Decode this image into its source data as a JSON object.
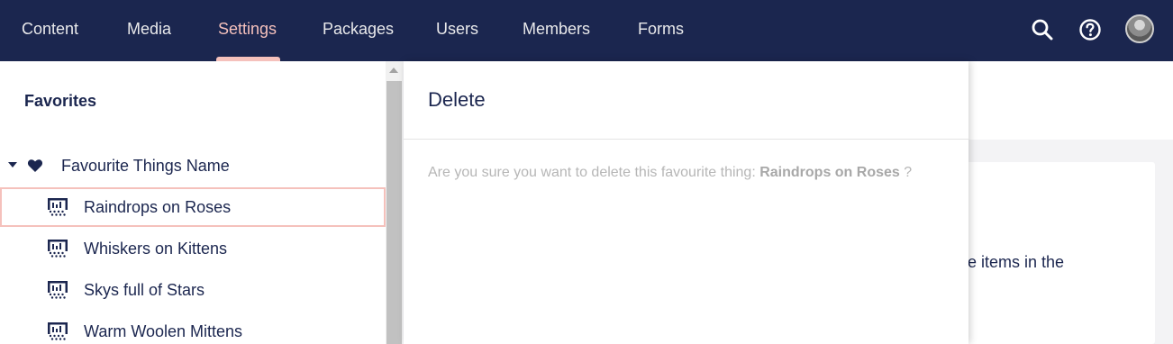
{
  "nav": {
    "items": [
      {
        "label": "Content"
      },
      {
        "label": "Media"
      },
      {
        "label": "Settings",
        "active": true
      },
      {
        "label": "Packages"
      },
      {
        "label": "Users"
      },
      {
        "label": "Members"
      },
      {
        "label": "Forms"
      }
    ],
    "icons": [
      "search-icon",
      "help-icon",
      "avatar"
    ]
  },
  "sidebar": {
    "heading": "Favorites",
    "root": {
      "label": "Favourite Things Name",
      "icon": "heart-icon",
      "expanded": true
    },
    "items": [
      {
        "label": "Raindrops on Roses",
        "icon": "document-type-icon",
        "selected": true
      },
      {
        "label": "Whiskers on Kittens",
        "icon": "document-type-icon"
      },
      {
        "label": "Skys full of Stars",
        "icon": "document-type-icon"
      },
      {
        "label": "Warm Woolen Mittens",
        "icon": "document-type-icon"
      }
    ]
  },
  "dialog": {
    "title": "Delete",
    "message_prefix": "Are you sure you want to delete this favourite thing: ",
    "item_name": "Raindrops on Roses",
    "message_suffix": " ?"
  },
  "background": {
    "partial_text": "ne items in the"
  },
  "colors": {
    "nav_bg": "#1b264f",
    "nav_active": "#f5c1bc",
    "text_primary": "#1b264f",
    "selected_border": "#f5c1bc"
  }
}
